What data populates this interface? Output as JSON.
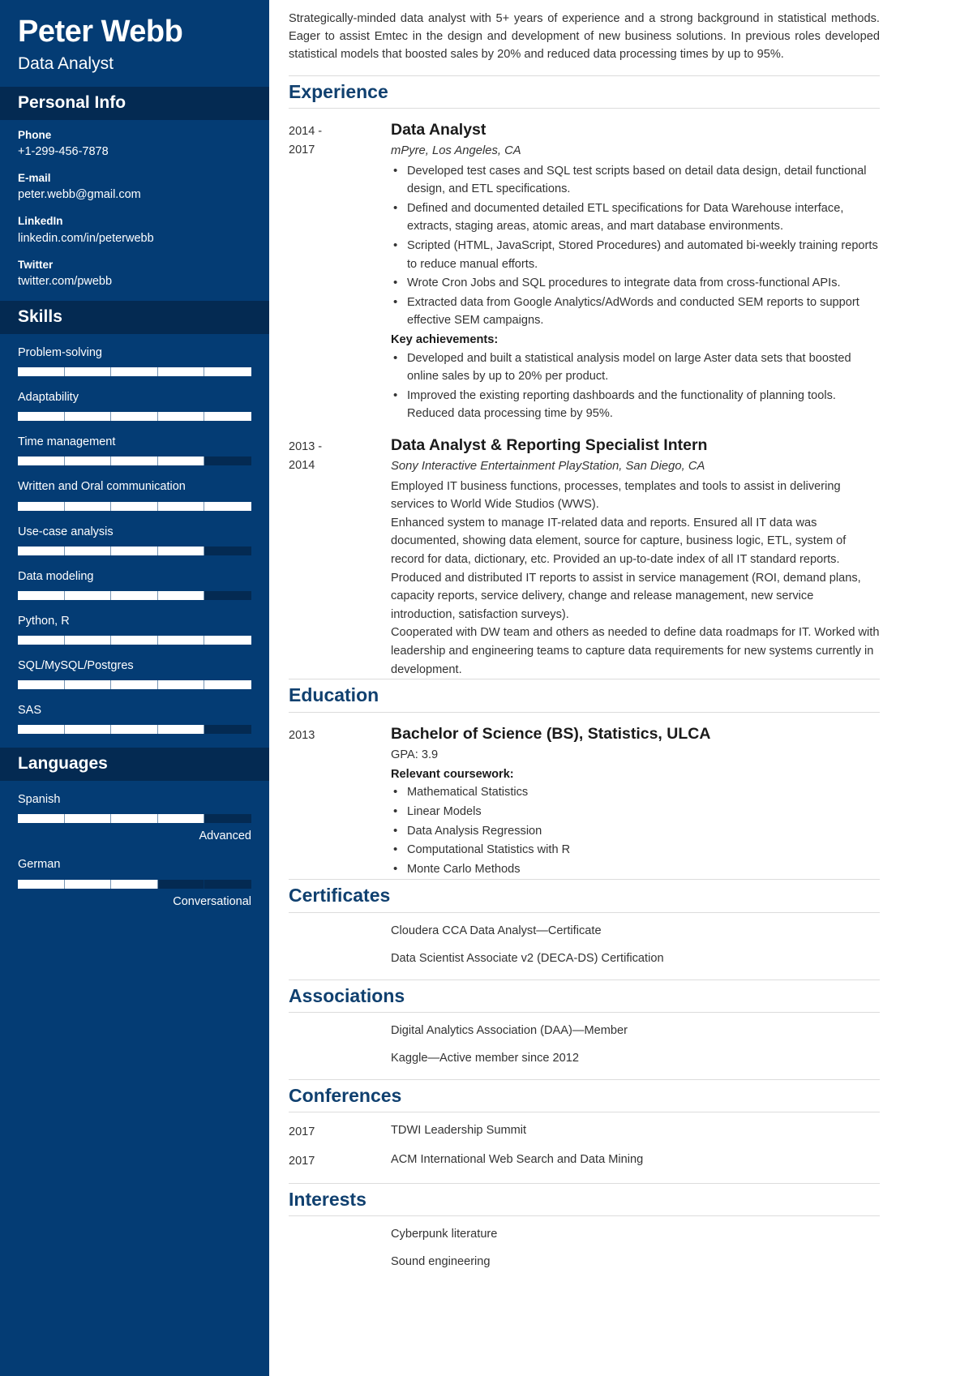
{
  "sidebar": {
    "full_name": "Peter Webb",
    "job_title": "Data Analyst",
    "personal_info": {
      "heading": "Personal Info",
      "items": [
        {
          "label": "Phone",
          "value": "+1-299-456-7878"
        },
        {
          "label": "E-mail",
          "value": "peter.webb@gmail.com"
        },
        {
          "label": "LinkedIn",
          "value": "linkedin.com/in/peterwebb"
        },
        {
          "label": "Twitter",
          "value": "twitter.com/pwebb"
        }
      ]
    },
    "skills": {
      "heading": "Skills",
      "items": [
        {
          "label": "Problem-solving",
          "level_percent": 100
        },
        {
          "label": "Adaptability",
          "level_percent": 100
        },
        {
          "label": "Time management",
          "level_percent": 80
        },
        {
          "label": "Written and Oral communication",
          "level_percent": 100
        },
        {
          "label": "Use-case analysis",
          "level_percent": 80
        },
        {
          "label": "Data modeling",
          "level_percent": 80
        },
        {
          "label": "Python, R",
          "level_percent": 100
        },
        {
          "label": "SQL/MySQL/Postgres",
          "level_percent": 100
        },
        {
          "label": "SAS",
          "level_percent": 80
        }
      ]
    },
    "languages": {
      "heading": "Languages",
      "items": [
        {
          "label": "Spanish",
          "level_percent": 80,
          "level_text": "Advanced"
        },
        {
          "label": "German",
          "level_percent": 60,
          "level_text": "Conversational"
        }
      ]
    }
  },
  "main": {
    "summary": "Strategically-minded data analyst with 5+ years of experience and a strong background in statistical methods. Eager to assist Emtec in the design and development of new business solutions. In previous roles developed statistical models that boosted sales by 20% and reduced data processing times by up to 95%.",
    "experience": {
      "heading": "Experience",
      "entries": [
        {
          "date": "2014 -\n2017",
          "role": "Data Analyst",
          "org": "mPyre, Los Angeles, CA",
          "bullets": [
            "Developed test cases and SQL test scripts based on detail data design, detail functional design, and ETL specifications.",
            "Defined and documented detailed ETL specifications for Data Warehouse interface, extracts, staging areas, atomic areas, and mart database environments.",
            "Scripted (HTML, JavaScript, Stored Procedures) and automated bi-weekly training reports to reduce manual efforts.",
            "Wrote Cron Jobs and SQL procedures to integrate data from cross-functional APIs.",
            "Extracted data from Google Analytics/AdWords and conducted SEM reports to support effective SEM campaigns."
          ],
          "achievements_heading": "Key achievements:",
          "achievements": [
            "Developed and built a statistical analysis model on large Aster data sets that boosted online sales by up to 20% per product.",
            "Improved the existing reporting dashboards and the functionality of planning tools. Reduced data processing time by 95%."
          ]
        },
        {
          "date": "2013 -\n2014",
          "role": "Data Analyst & Reporting Specialist Intern",
          "org": "Sony Interactive Entertainment PlayStation, San Diego, CA",
          "paragraphs": [
            "Employed IT business functions, processes, templates and tools to assist in delivering services to World Wide Studios (WWS).",
            "Enhanced system to manage IT-related data and reports. Ensured all IT data was documented, showing data element, source for capture, business logic, ETL, system of record for data, dictionary, etc. Provided an up-to-date index of all IT standard reports.",
            "Produced and distributed IT reports to assist in service management (ROI, demand plans, capacity reports, service delivery, change and release management, new service introduction, satisfaction surveys).",
            "Cooperated with DW team and others as needed to define data roadmaps for IT. Worked with leadership and engineering teams to capture data requirements for new systems currently in development."
          ]
        }
      ]
    },
    "education": {
      "heading": "Education",
      "entries": [
        {
          "date": "2013",
          "degree": "Bachelor of Science (BS), Statistics, ULCA",
          "gpa": "GPA: 3.9",
          "coursework_heading": "Relevant coursework:",
          "coursework": [
            "Mathematical Statistics",
            "Linear Models",
            "Data Analysis Regression",
            "Computational Statistics with R",
            "Monte Carlo Methods"
          ]
        }
      ]
    },
    "certificates": {
      "heading": "Certificates",
      "items": [
        {
          "date": "",
          "text": "Cloudera CCA Data Analyst—Certificate"
        },
        {
          "date": "",
          "text": "Data Scientist Associate v2 (DECA-DS) Certification"
        }
      ]
    },
    "associations": {
      "heading": "Associations",
      "items": [
        {
          "date": "",
          "text": "Digital Analytics Association (DAA)—Member"
        },
        {
          "date": "",
          "text": "Kaggle—Active member since 2012"
        }
      ]
    },
    "conferences": {
      "heading": "Conferences",
      "items": [
        {
          "date": "2017",
          "text": "TDWI Leadership Summit"
        },
        {
          "date": "2017",
          "text": "ACM International Web Search and Data Mining"
        }
      ]
    },
    "interests": {
      "heading": "Interests",
      "items": [
        {
          "date": "",
          "text": "Cyberpunk literature"
        },
        {
          "date": "",
          "text": "Sound engineering"
        }
      ]
    }
  },
  "colors": {
    "sidebar_bg": "#043c74",
    "sidebar_header_bg": "#042a52",
    "accent_heading": "#10406f",
    "bar_fill": "#ffffff",
    "rule": "#dcdcdc"
  }
}
